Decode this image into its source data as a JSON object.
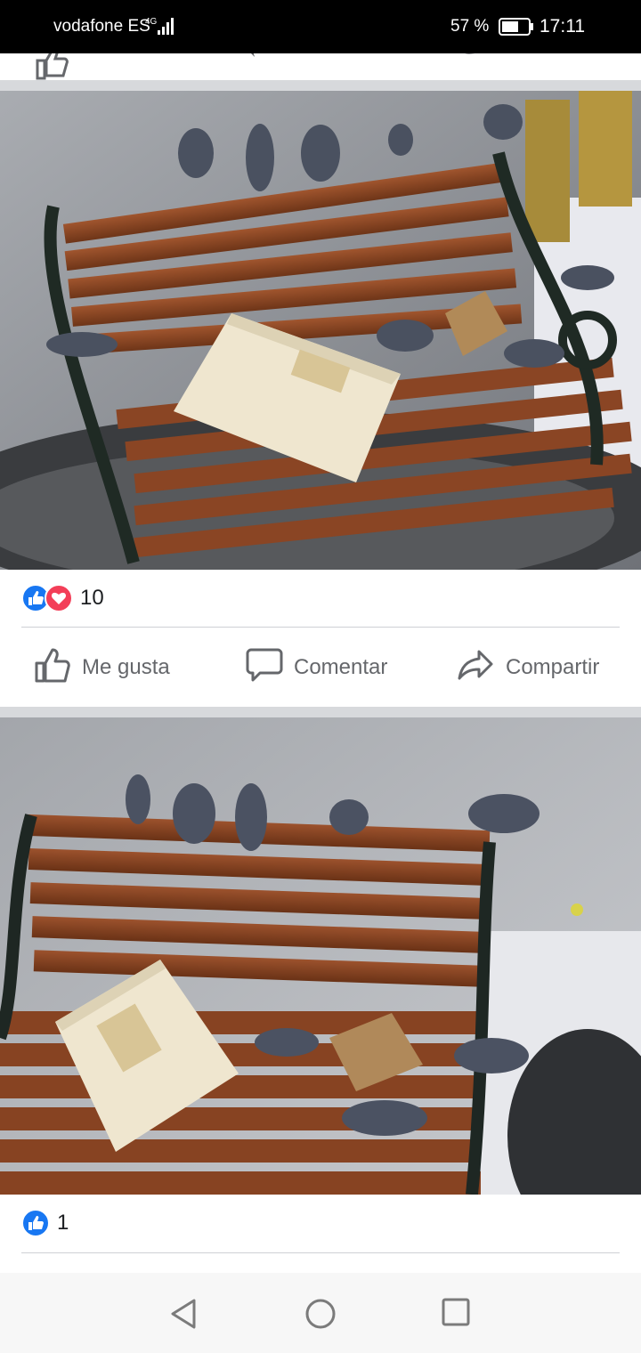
{
  "status_bar": {
    "carrier": "vodafone ES",
    "network": "4G",
    "battery_percent": "57 %",
    "time": "17:11",
    "icons": [
      "signal-icon",
      "battery-icon"
    ]
  },
  "posts": [
    {
      "reactions": {
        "types": [
          "like",
          "love"
        ],
        "count": "10"
      },
      "actions": {
        "like": "Me gusta",
        "comment": "Comentar",
        "share": "Compartir"
      }
    },
    {
      "reactions": {
        "types": [
          "like"
        ],
        "count": "1"
      }
    }
  ],
  "system_nav": {
    "buttons": [
      "back-icon",
      "home-icon",
      "recents-icon"
    ]
  },
  "colors": {
    "like_blue": "#1877f2",
    "love_red": "#f33e58",
    "action_gray": "#65676b",
    "divider_gray": "#d7d9dc"
  }
}
